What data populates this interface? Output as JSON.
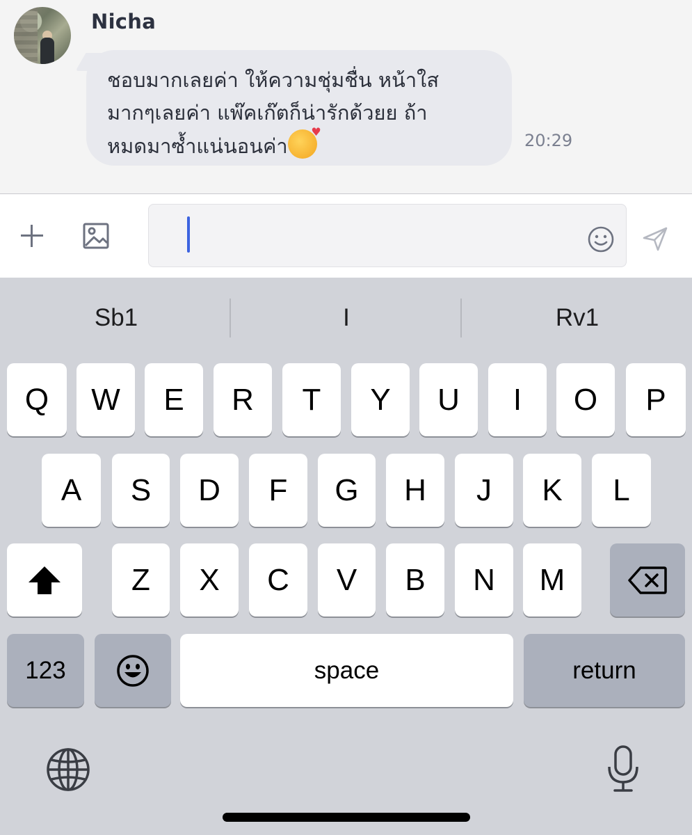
{
  "chat": {
    "sender_name": "Nicha",
    "message_text": "ชอบมากเลยค่า ให้ความชุ่มชื่น หน้าใส\nมากๆเลยค่า แพ๊คเก๊ตก็น่ารักด้วยย ถ้า\nหมดมาซ้ำแน่นอนค่า",
    "message_emoji": "smiling-face-with-hearts",
    "message_time": "20:29"
  },
  "input_bar": {
    "icons": [
      "plus-icon",
      "image-icon",
      "emoji-icon",
      "send-icon"
    ],
    "text_value": ""
  },
  "keyboard": {
    "suggestions": [
      "Sb1",
      "I",
      "Rv1"
    ],
    "row1": [
      "Q",
      "W",
      "E",
      "R",
      "T",
      "Y",
      "U",
      "I",
      "O",
      "P"
    ],
    "row2": [
      "A",
      "S",
      "D",
      "F",
      "G",
      "H",
      "J",
      "K",
      "L"
    ],
    "row3": [
      "Z",
      "X",
      "C",
      "V",
      "B",
      "N",
      "M"
    ],
    "numbers_label": "123",
    "space_label": "space",
    "return_label": "return",
    "icons": [
      "shift-icon",
      "backspace-icon",
      "emoji-keyboard-icon",
      "globe-icon",
      "microphone-icon"
    ]
  },
  "colors": {
    "accent_cursor": "#3c63e0",
    "chat_bg": "#f4f4f4",
    "bubble_bg": "#e8e9ee",
    "keyboard_bg": "#d1d3d9",
    "dark_key": "#abb0bc"
  }
}
